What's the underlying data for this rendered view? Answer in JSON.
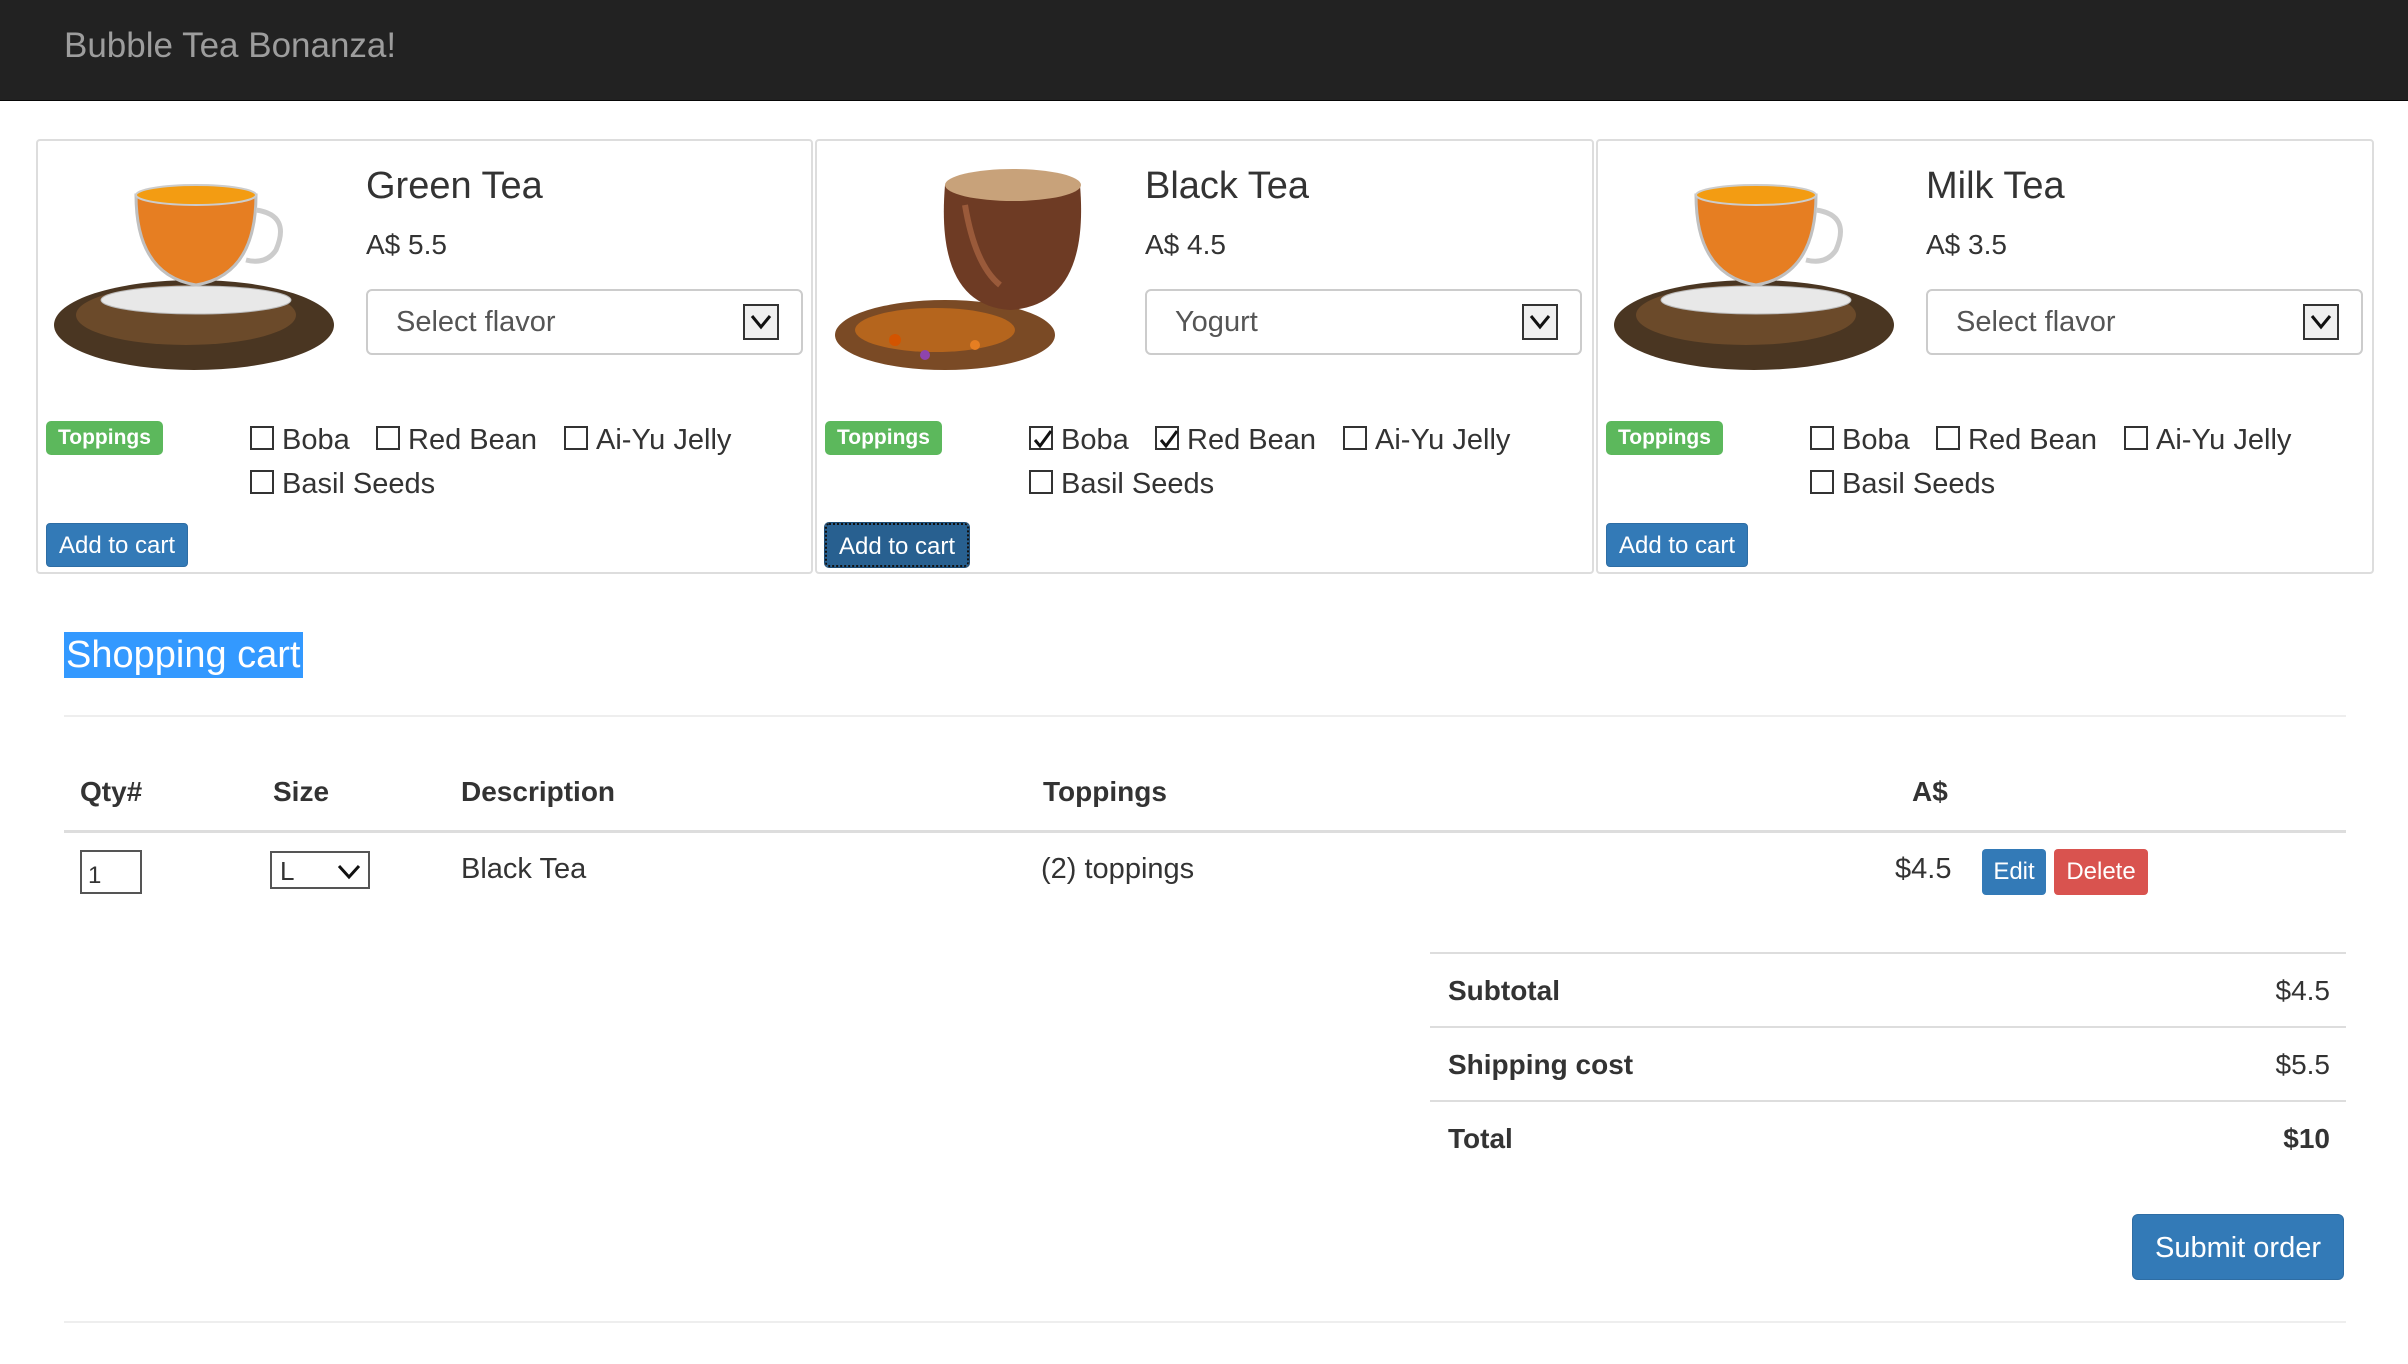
{
  "app": {
    "brand": "Bubble Tea Bonanza!"
  },
  "products": [
    {
      "name": "Green Tea",
      "price": "A$ 5.5",
      "flavor": "Select flavor",
      "toppings_label": "Toppings",
      "options": [
        {
          "label": "Boba",
          "checked": false
        },
        {
          "label": "Red Bean",
          "checked": false
        },
        {
          "label": "Ai-Yu Jelly",
          "checked": false
        },
        {
          "label": "Basil Seeds",
          "checked": false
        }
      ],
      "add_label": "Add to cart"
    },
    {
      "name": "Black Tea",
      "price": "A$ 4.5",
      "flavor": "Yogurt",
      "toppings_label": "Toppings",
      "options": [
        {
          "label": "Boba",
          "checked": true
        },
        {
          "label": "Red Bean",
          "checked": true
        },
        {
          "label": "Ai-Yu Jelly",
          "checked": false
        },
        {
          "label": "Basil Seeds",
          "checked": false
        }
      ],
      "add_label": "Add to cart"
    },
    {
      "name": "Milk Tea",
      "price": "A$ 3.5",
      "flavor": "Select flavor",
      "toppings_label": "Toppings",
      "options": [
        {
          "label": "Boba",
          "checked": false
        },
        {
          "label": "Red Bean",
          "checked": false
        },
        {
          "label": "Ai-Yu Jelly",
          "checked": false
        },
        {
          "label": "Basil Seeds",
          "checked": false
        }
      ],
      "add_label": "Add to cart"
    }
  ],
  "cart": {
    "title": "Shopping cart",
    "headers": [
      "Qty#",
      "Size",
      "Description",
      "Toppings",
      "A$"
    ],
    "rows": [
      {
        "qty": "1",
        "size": "L",
        "description": "Black Tea",
        "toppings": "(2) toppings",
        "price": "$4.5",
        "edit_label": "Edit",
        "delete_label": "Delete"
      }
    ],
    "summary": {
      "subtotal_label": "Subtotal",
      "subtotal": "$4.5",
      "shipping_label": "Shipping cost",
      "shipping": "$5.5",
      "total_label": "Total",
      "total": "$10"
    },
    "submit_label": "Submit order"
  },
  "colors": {
    "navbar": "#222222",
    "primary": "#337ab7",
    "success": "#5cb85c",
    "danger": "#d9534f",
    "selection": "#3399ff"
  }
}
